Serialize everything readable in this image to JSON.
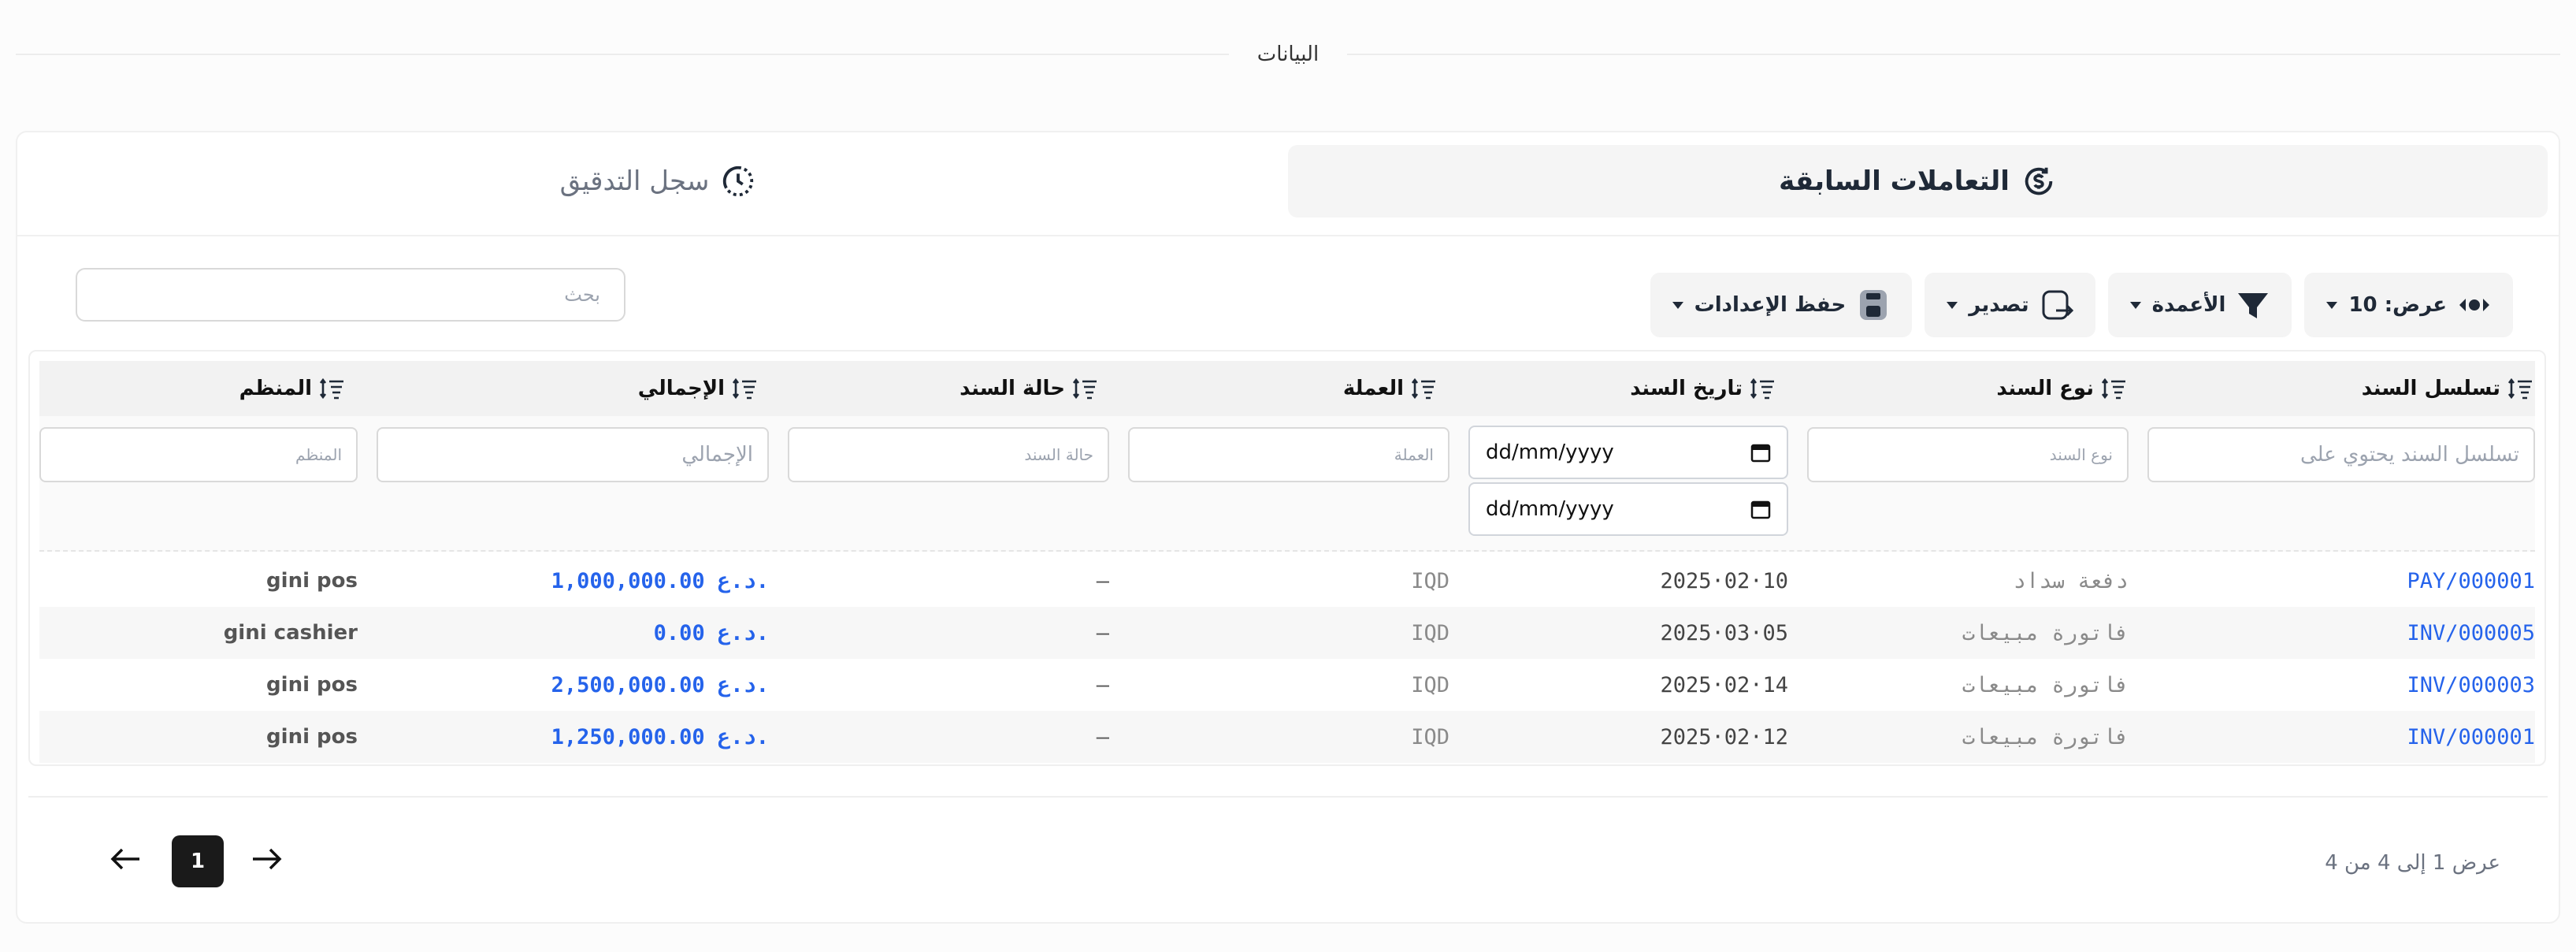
{
  "section": {
    "title": "البيانات"
  },
  "tabs": [
    {
      "label": "سجل التدقيق",
      "icon": "history-icon",
      "active": false
    },
    {
      "label": "التعاملات السابقة",
      "icon": "dollar-refresh-icon",
      "active": true
    }
  ],
  "toolbar": {
    "search_placeholder": "بحث",
    "show_label": "عرض: 10",
    "columns_label": "الأعمدة",
    "export_label": "تصدير",
    "save_settings_label": "حفظ الإعدادات"
  },
  "table": {
    "headers": [
      "تسلسل السند",
      "نوع السند",
      "تاريخ السند",
      "العملة",
      "حالة السند",
      "الإجمالي",
      "المنظم"
    ],
    "filters": {
      "sequence_placeholder": "تسلسل السند يحتوي على",
      "type_placeholder": "نوع السند",
      "date_placeholder": "dd/mm/yyyy",
      "currency_placeholder": "العملة",
      "status_placeholder": "حالة السند",
      "total_placeholder": "الإجمالي",
      "organizer_placeholder": "المنظم"
    },
    "rows": [
      {
        "sequence": "PAY/000001",
        "type": "دفعة سداد",
        "date": "2025·02·10",
        "currency": "IQD",
        "status": "—",
        "total": "1,000,000.00 د.ع.",
        "organizer": "gini pos"
      },
      {
        "sequence": "INV/000005",
        "type": "فاتورة مبيعات",
        "date": "2025·03·05",
        "currency": "IQD",
        "status": "—",
        "total": "0.00 د.ع.",
        "organizer": "gini cashier"
      },
      {
        "sequence": "INV/000003",
        "type": "فاتورة مبيعات",
        "date": "2025·02·14",
        "currency": "IQD",
        "status": "—",
        "total": "2,500,000.00 د.ع.",
        "organizer": "gini pos"
      },
      {
        "sequence": "INV/000001",
        "type": "فاتورة مبيعات",
        "date": "2025·02·12",
        "currency": "IQD",
        "status": "—",
        "total": "1,250,000.00 د.ع.",
        "organizer": "gini pos"
      }
    ]
  },
  "pagination": {
    "summary": "عرض 1 إلى 4 من 4",
    "current_page": "1"
  },
  "colors": {
    "accent": "#2563eb",
    "dark": "#1a1a1a"
  }
}
